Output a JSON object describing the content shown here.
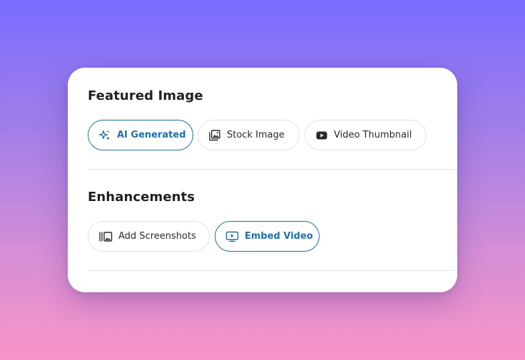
{
  "featured_image": {
    "title": "Featured Image",
    "options": [
      {
        "label": "AI Generated",
        "icon": "sparkle-icon",
        "selected": true
      },
      {
        "label": "Stock Image",
        "icon": "image-gallery-icon",
        "selected": false
      },
      {
        "label": "Video Thumbnail",
        "icon": "youtube-play-icon",
        "selected": false
      }
    ]
  },
  "enhancements": {
    "title": "Enhancements",
    "options": [
      {
        "label": "Add Screenshots",
        "icon": "screenshots-icon",
        "selected": false
      },
      {
        "label": "Embed Video",
        "icon": "embed-video-icon",
        "selected": true
      }
    ]
  },
  "colors": {
    "selected_accent": "#1f6fa6",
    "pill_border": "#e3e3e7",
    "text": "#1f1f24"
  }
}
